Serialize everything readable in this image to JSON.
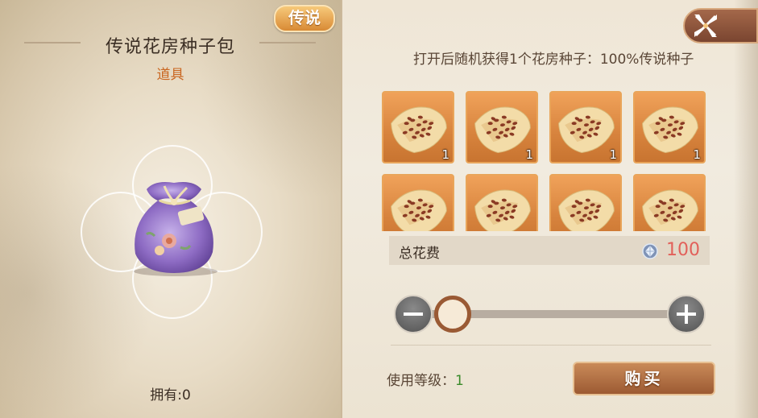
{
  "item": {
    "rarity_badge": "传说",
    "name": "传说花房种子包",
    "category": "道具",
    "owned_label": "拥有:0"
  },
  "detail": {
    "description": "打开后随机获得1个花房种子：100%传说种子",
    "seeds": [
      {
        "count": "1"
      },
      {
        "count": "1"
      },
      {
        "count": "1"
      },
      {
        "count": "1"
      },
      {
        "count": ""
      },
      {
        "count": ""
      },
      {
        "count": ""
      },
      {
        "count": ""
      }
    ],
    "cost_label": "总花费",
    "cost_value": "100",
    "quantity_fraction": 0.0,
    "level_label": "使用等级：",
    "level_value": "1",
    "buy_label": "购买"
  },
  "icons": {
    "close": "close-x-icon",
    "currency": "diamond-icon",
    "minus": "minus-icon",
    "plus": "plus-icon",
    "item": "seed-bag-icon",
    "seed": "seed-pile-icon"
  },
  "colors": {
    "badge": "#d88a35",
    "category": "#c9651f",
    "cost_value": "#e2605a",
    "level_value": "#3a8a2a",
    "slot_border": "#e9a55a"
  }
}
